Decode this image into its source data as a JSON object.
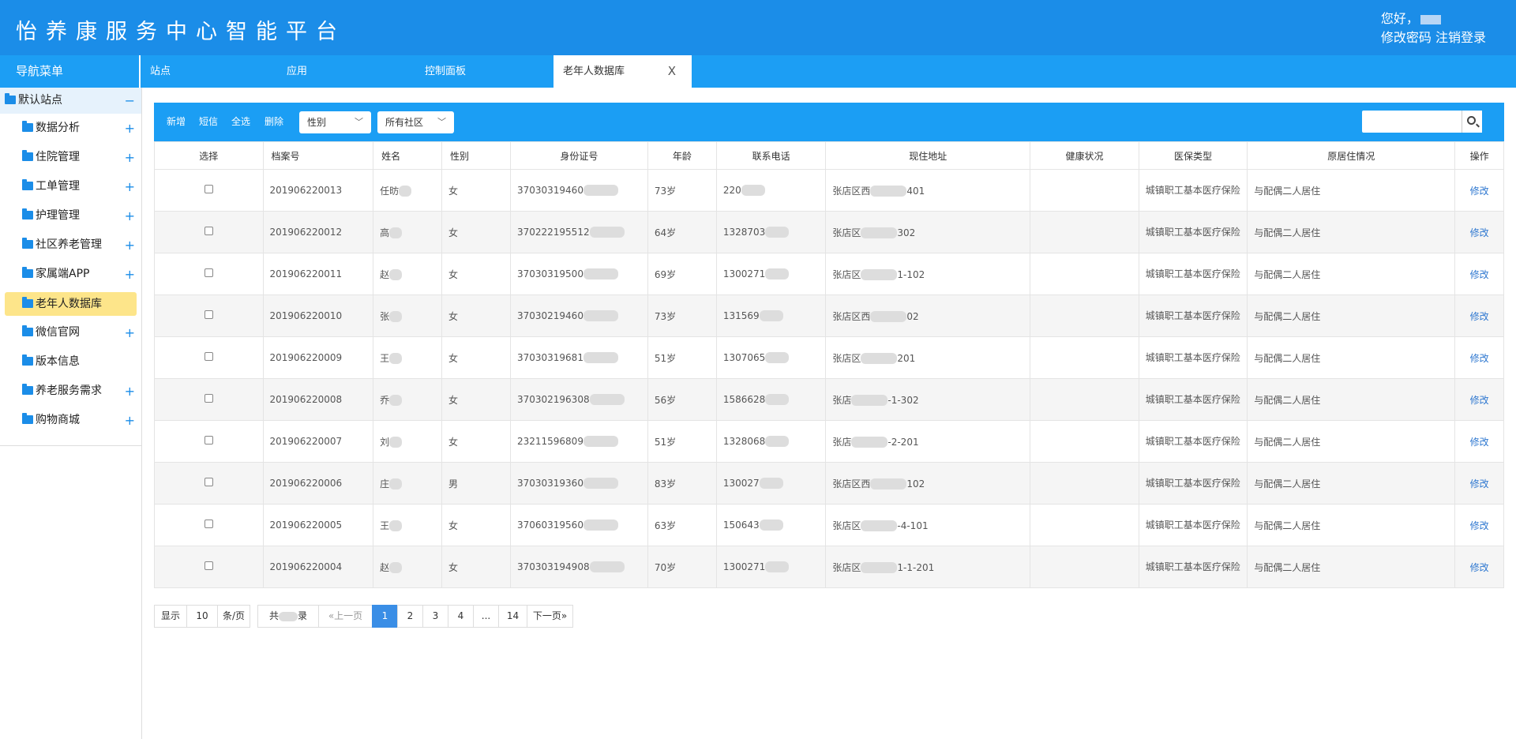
{
  "app": {
    "title": "怡养康服务中心智能平台"
  },
  "user": {
    "greeting": "您好，",
    "change_password": "修改密码",
    "logout": "注销登录"
  },
  "nav": {
    "title": "导航菜单",
    "tabs": [
      {
        "label": "站点"
      },
      {
        "label": "应用"
      },
      {
        "label": "控制面板"
      },
      {
        "label": "老年人数据库",
        "close": "X"
      }
    ]
  },
  "sidebar": {
    "root": "默认站点",
    "root_toggle": "−",
    "expand": "+",
    "items": [
      {
        "label": "数据分析"
      },
      {
        "label": "住院管理"
      },
      {
        "label": "工单管理"
      },
      {
        "label": "护理管理"
      },
      {
        "label": "社区养老管理"
      },
      {
        "label": "家属端APP"
      },
      {
        "label": "老年人数据库"
      },
      {
        "label": "微信官网"
      },
      {
        "label": "版本信息"
      },
      {
        "label": "养老服务需求"
      },
      {
        "label": "购物商城"
      }
    ]
  },
  "toolbar": {
    "add": "新增",
    "sms": "短信",
    "select_all": "全选",
    "delete": "删除",
    "gender_select": "性别",
    "community_select": "所有社区",
    "search_icon": "search-icon",
    "accent": "#1b9ef4"
  },
  "table": {
    "headers": [
      "选择",
      "档案号",
      "姓名",
      "性别",
      "身份证号",
      "年龄",
      "联系电话",
      "现住地址",
      "健康状况",
      "医保类型",
      "原居住情况",
      "操作"
    ],
    "rows": [
      {
        "id": "201906220013",
        "name": "任昉",
        "gender": "女",
        "idno": "37030319460",
        "age": "73岁",
        "phone": "220",
        "address": "张店区西",
        "address_end": "401",
        "insurance": "城镇职工基本医疗保险",
        "living": "与配偶二人居住",
        "action": "修改"
      },
      {
        "id": "201906220012",
        "name": "高",
        "gender": "女",
        "idno": "370222195512",
        "age": "64岁",
        "phone": "1328703",
        "address": "张店区",
        "address_end": "302",
        "insurance": "城镇职工基本医疗保险",
        "living": "与配偶二人居住",
        "action": "修改"
      },
      {
        "id": "201906220011",
        "name": "赵",
        "gender": "女",
        "idno": "37030319500",
        "age": "69岁",
        "phone": "1300271",
        "address": "张店区",
        "address_end": "1-102",
        "insurance": "城镇职工基本医疗保险",
        "living": "与配偶二人居住",
        "action": "修改"
      },
      {
        "id": "201906220010",
        "name": "张",
        "gender": "女",
        "idno": "37030219460",
        "age": "73岁",
        "phone": "131569",
        "address": "张店区西",
        "address_end": "02",
        "insurance": "城镇职工基本医疗保险",
        "living": "与配偶二人居住",
        "action": "修改"
      },
      {
        "id": "201906220009",
        "name": "王",
        "gender": "女",
        "idno": "37030319681",
        "age": "51岁",
        "phone": "1307065",
        "address": "张店区",
        "address_end": "201",
        "insurance": "城镇职工基本医疗保险",
        "living": "与配偶二人居住",
        "action": "修改"
      },
      {
        "id": "201906220008",
        "name": "乔",
        "gender": "女",
        "idno": "370302196308",
        "age": "56岁",
        "phone": "1586628",
        "address": "张店",
        "address_end": "-1-302",
        "insurance": "城镇职工基本医疗保险",
        "living": "与配偶二人居住",
        "action": "修改"
      },
      {
        "id": "201906220007",
        "name": "刘",
        "gender": "女",
        "idno": "23211596809",
        "age": "51岁",
        "phone": "1328068",
        "address": "张店",
        "address_end": "-2-201",
        "insurance": "城镇职工基本医疗保险",
        "living": "与配偶二人居住",
        "action": "修改"
      },
      {
        "id": "201906220006",
        "name": "庄",
        "gender": "男",
        "idno": "37030319360",
        "age": "83岁",
        "phone": "130027",
        "address": "张店区西",
        "address_end": "102",
        "insurance": "城镇职工基本医疗保险",
        "living": "与配偶二人居住",
        "action": "修改"
      },
      {
        "id": "201906220005",
        "name": "王",
        "gender": "女",
        "idno": "37060319560",
        "age": "63岁",
        "phone": "150643",
        "address": "张店区",
        "address_end": "-4-101",
        "insurance": "城镇职工基本医疗保险",
        "living": "与配偶二人居住",
        "action": "修改"
      },
      {
        "id": "201906220004",
        "name": "赵",
        "gender": "女",
        "idno": "370303194908",
        "age": "70岁",
        "phone": "1300271",
        "address": "张店区",
        "address_end": "1-1-201",
        "insurance": "城镇职工基本医疗保险",
        "living": "与配偶二人居住",
        "action": "修改"
      }
    ]
  },
  "pager": {
    "show": "显示",
    "page_size": "10",
    "per_page": "条/页",
    "total_prefix": "共",
    "total_suffix": "录",
    "prev": "«上一页",
    "pages": [
      "1",
      "2",
      "3",
      "4",
      "...",
      "14"
    ],
    "next": "下一页»",
    "current": "1"
  }
}
